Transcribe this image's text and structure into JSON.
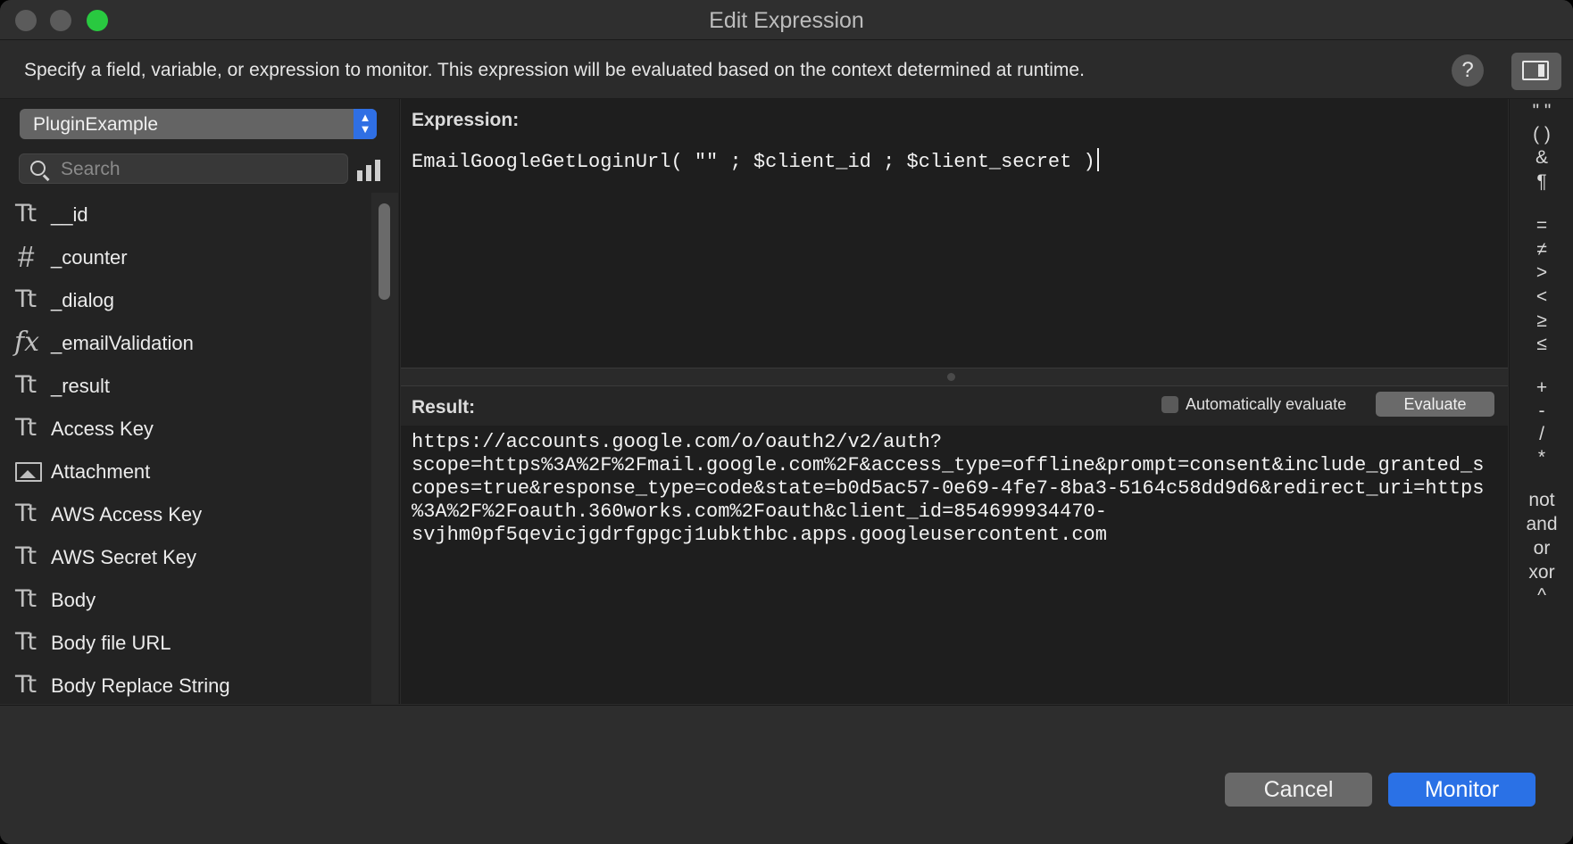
{
  "window": {
    "title": "Edit Expression"
  },
  "description": "Specify a field, variable, or expression to monitor. This expression will be evaluated based on the context determined at runtime.",
  "toolbar": {
    "help_label": "?"
  },
  "left_panel": {
    "file_selector": "PluginExample",
    "search_placeholder": "Search",
    "fields": [
      {
        "icon": "text-type-icon",
        "icon_glyph": "Tt",
        "name": "__id"
      },
      {
        "icon": "number-type-icon",
        "icon_glyph": "#",
        "name": "_counter"
      },
      {
        "icon": "text-type-icon",
        "icon_glyph": "Tt",
        "name": "_dialog"
      },
      {
        "icon": "calculation-fx-icon",
        "icon_glyph": "fx",
        "name": "_emailValidation"
      },
      {
        "icon": "text-type-icon",
        "icon_glyph": "Tt",
        "name": "_result"
      },
      {
        "icon": "text-type-icon",
        "icon_glyph": "Tt",
        "name": "Access Key"
      },
      {
        "icon": "container-image-icon",
        "icon_glyph": "",
        "name": "Attachment"
      },
      {
        "icon": "text-type-icon",
        "icon_glyph": "Tt",
        "name": "AWS Access Key"
      },
      {
        "icon": "text-type-icon",
        "icon_glyph": "Tt",
        "name": "AWS Secret Key"
      },
      {
        "icon": "text-type-icon",
        "icon_glyph": "Tt",
        "name": "Body"
      },
      {
        "icon": "text-type-icon",
        "icon_glyph": "Tt",
        "name": "Body file URL"
      },
      {
        "icon": "text-type-icon",
        "icon_glyph": "Tt",
        "name": "Body Replace String"
      }
    ]
  },
  "expression": {
    "label": "Expression:",
    "text": "EmailGoogleGetLoginUrl( \"\" ; $client_id ; $client_secret )"
  },
  "result": {
    "label": "Result:",
    "auto_evaluate_label": "Automatically evaluate",
    "auto_evaluate_checked": false,
    "evaluate_label": "Evaluate",
    "lines": [
      "https://accounts.google.com/o/oauth2/v2/auth?",
      "scope=https%3A%2F%2Fmail.google.com%2F&access_type=offline&prompt=consent&include_granted_s",
      "copes=true&response_type=code&state=b0d5ac57-0e69-4fe7-8ba3-5164c58dd9d6&redirect_uri=https",
      "%3A%2F%2Foauth.360works.com%2Foauth&client_id=854699934470-",
      "svjhm0pf5qevicjgdrfgpgcj1ubkthbc.apps.googleusercontent.com"
    ]
  },
  "operators": [
    "\" \"",
    "( )",
    "&",
    "¶",
    "=",
    "≠",
    ">",
    "<",
    "≥",
    "≤",
    "+",
    "-",
    "/",
    "*",
    "not",
    "and",
    "or",
    "xor",
    "^"
  ],
  "footer": {
    "cancel_label": "Cancel",
    "monitor_label": "Monitor"
  },
  "colors": {
    "accent": "#2a71e6",
    "zoom_button": "#29c940"
  }
}
